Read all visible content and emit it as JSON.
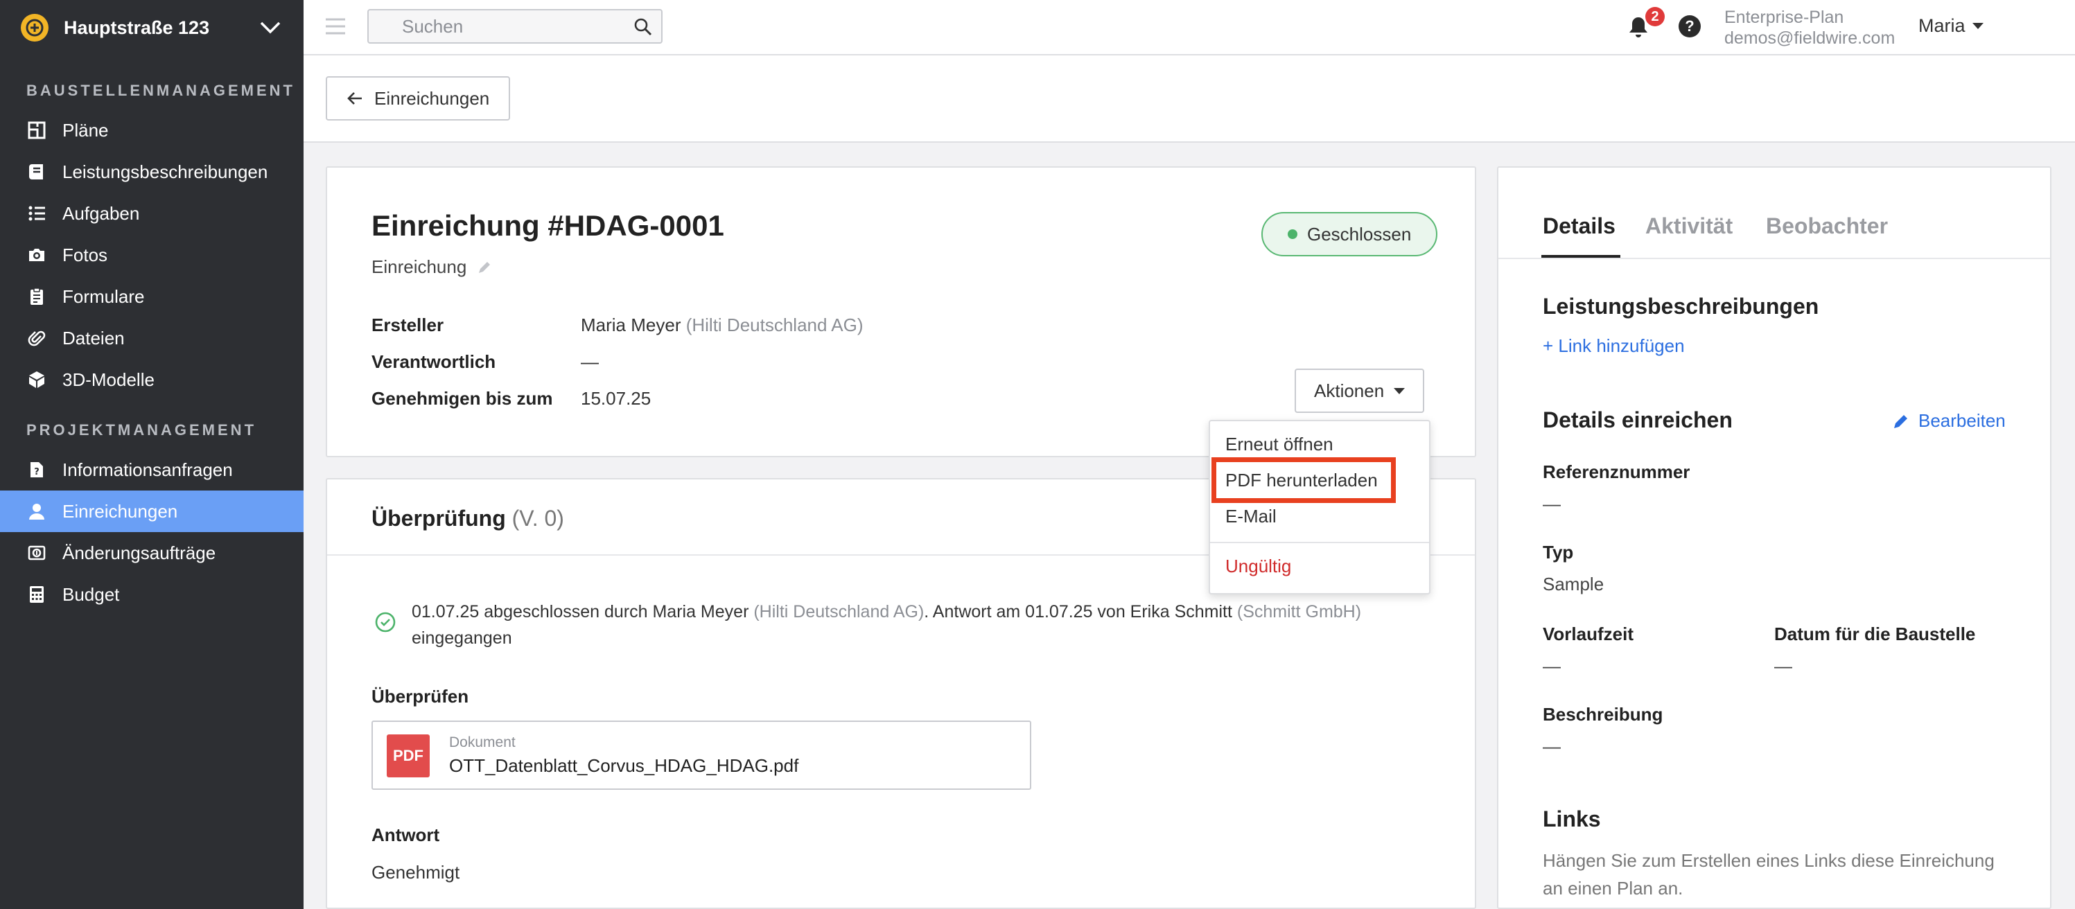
{
  "sidebar": {
    "project_name": "Hauptstraße 123",
    "section1_title": "BAUSTELLENMANAGEMENT",
    "section1_items": [
      {
        "label": "Pläne",
        "icon": "plans-icon"
      },
      {
        "label": "Leistungsbeschreibungen",
        "icon": "specs-icon"
      },
      {
        "label": "Aufgaben",
        "icon": "tasks-icon"
      },
      {
        "label": "Fotos",
        "icon": "camera-icon"
      },
      {
        "label": "Formulare",
        "icon": "forms-icon"
      },
      {
        "label": "Dateien",
        "icon": "paperclip-icon"
      },
      {
        "label": "3D-Modelle",
        "icon": "cube-icon"
      }
    ],
    "section2_title": "PROJEKTMANAGEMENT",
    "section2_items": [
      {
        "label": "Informationsanfragen",
        "icon": "rfi-icon"
      },
      {
        "label": "Einreichungen",
        "icon": "submittal-icon",
        "active": true
      },
      {
        "label": "Änderungsaufträge",
        "icon": "change-order-icon"
      },
      {
        "label": "Budget",
        "icon": "calculator-icon"
      }
    ]
  },
  "topbar": {
    "search_placeholder": "Suchen",
    "notification_count": "2",
    "help_label": "?",
    "plan_name": "Enterprise-Plan",
    "account_email": "demos@fieldwire.com",
    "user_name": "Maria"
  },
  "back_button_label": "Einreichungen",
  "submittal": {
    "title": "Einreichung #HDAG-0001",
    "subtitle": "Einreichung",
    "status": "Geschlossen",
    "creator_label": "Ersteller",
    "creator_name": "Maria Meyer",
    "creator_company": "(Hilti Deutschland AG)",
    "responsible_label": "Verantwortlich",
    "responsible_value": "—",
    "approve_by_label": "Genehmigen bis zum",
    "approve_by_value": "15.07.25",
    "actions_label": "Aktionen"
  },
  "actions_menu": {
    "reopen": "Erneut öffnen",
    "download_pdf": "PDF herunterladen",
    "email": "E-Mail",
    "invalid": "Ungültig"
  },
  "review": {
    "title": "Überprüfung",
    "version": "(V. 0)",
    "log_part1": "01.07.25 abgeschlossen durch Maria Meyer",
    "log_company1": "(Hilti Deutschland AG)",
    "log_part2": ". Antwort am 01.07.25 von Erika Schmitt",
    "log_company2": "(Schmitt GmbH)",
    "log_part3": "eingegangen",
    "review_label": "Überprüfen",
    "doc_icon_label": "PDF",
    "doc_type": "Dokument",
    "doc_name": "OTT_Datenblatt_Corvus_HDAG_HDAG.pdf",
    "answer_label": "Antwort",
    "answer_value": "Genehmigt"
  },
  "details": {
    "tabs": [
      "Details",
      "Aktivität",
      "Beobachter"
    ],
    "specs_title": "Leistungsbeschreibungen",
    "add_link": "+ Link hinzufügen",
    "submit_details_title": "Details einreichen",
    "edit_label": "Bearbeiten",
    "reference_label": "Referenznummer",
    "reference_value": "—",
    "type_label": "Typ",
    "type_value": "Sample",
    "lead_time_label": "Vorlaufzeit",
    "lead_time_value": "—",
    "site_date_label": "Datum für die Baustelle",
    "site_date_value": "—",
    "description_label": "Beschreibung",
    "description_value": "—",
    "links_title": "Links",
    "links_hint": "Hängen Sie zum Erstellen eines Links diese Einreichung an einen Plan an."
  },
  "colors": {
    "sidebar_bg": "#2d2f33",
    "active_nav": "#6a9ff5",
    "status_green": "#4cb36a",
    "link_blue": "#2b6ee0",
    "danger_red": "#d02b2b",
    "highlight": "#e8401f"
  }
}
